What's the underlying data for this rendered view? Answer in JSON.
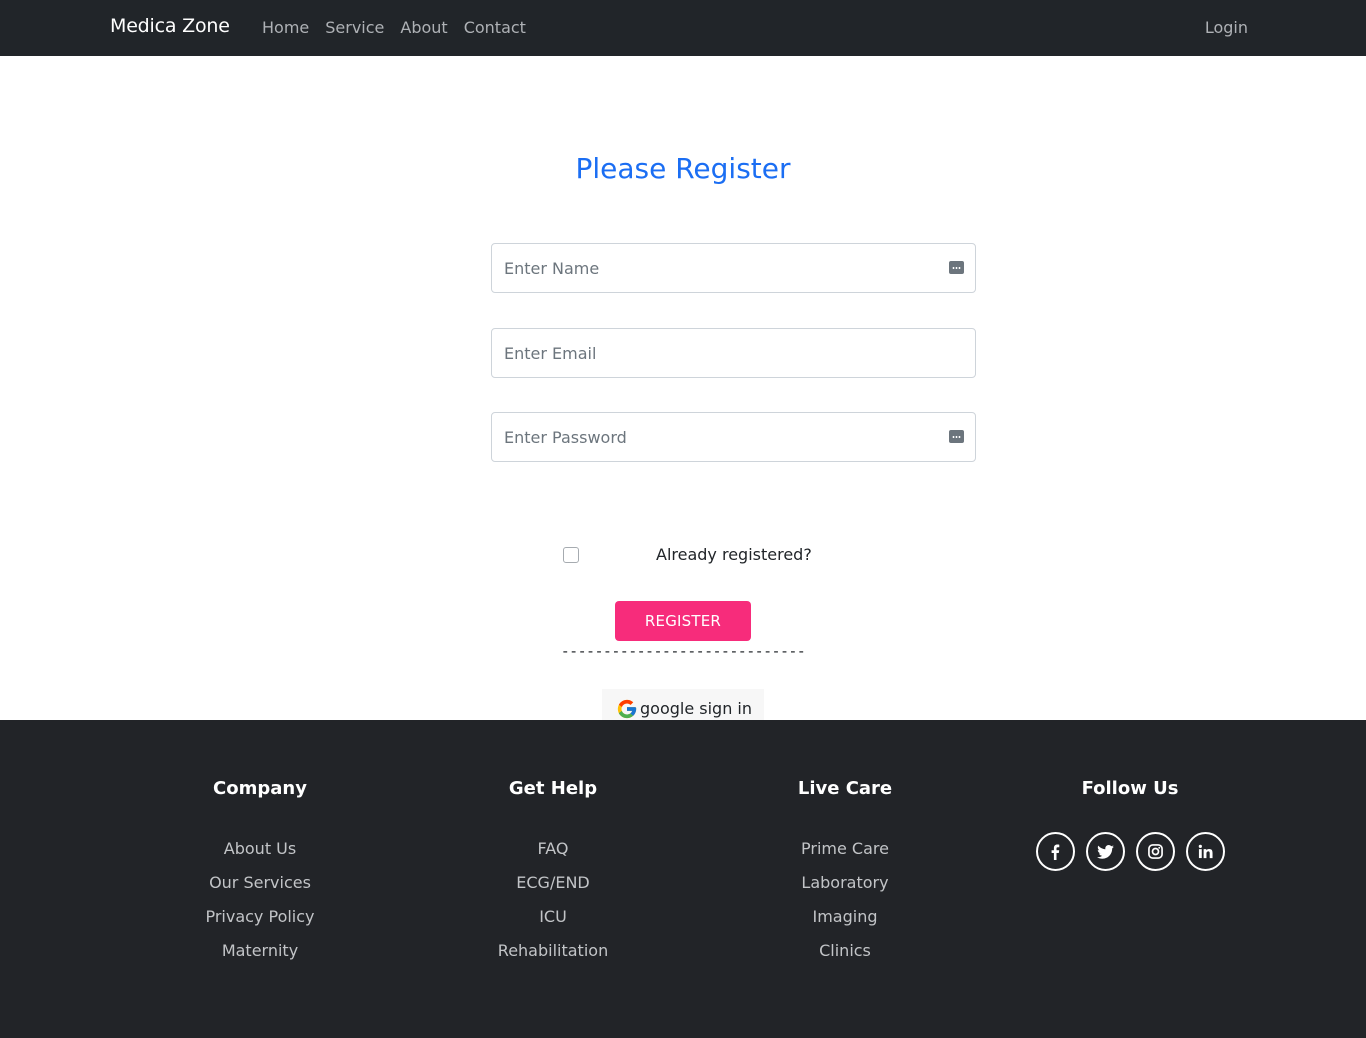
{
  "navbar": {
    "brand": "Medica Zone",
    "links": [
      "Home",
      "Service",
      "About",
      "Contact"
    ],
    "login": "Login"
  },
  "form": {
    "title": "Please Register",
    "name_placeholder": "Enter Name",
    "email_placeholder": "Enter Email",
    "password_placeholder": "Enter Password",
    "checkbox_label": "Already registered?",
    "register_label": "REGISTER",
    "divider": "-----------------------------",
    "google_label": "google sign in"
  },
  "footer": {
    "columns": [
      {
        "title": "Company",
        "items": [
          "About Us",
          "Our Services",
          "Privacy Policy",
          "Maternity"
        ]
      },
      {
        "title": "Get Help",
        "items": [
          "FAQ",
          "ECG/END",
          "ICU",
          "Rehabilitation"
        ]
      },
      {
        "title": "Live Care",
        "items": [
          "Prime Care",
          "Laboratory",
          "Imaging",
          "Clinics"
        ]
      }
    ],
    "follow_title": "Follow Us",
    "social": [
      "facebook-icon",
      "twitter-icon",
      "instagram-icon",
      "linkedin-icon"
    ]
  },
  "colors": {
    "navbar_bg": "#212529",
    "footer_bg": "#222428",
    "title": "#1b6ef3",
    "register_button": "#f72c7b"
  }
}
